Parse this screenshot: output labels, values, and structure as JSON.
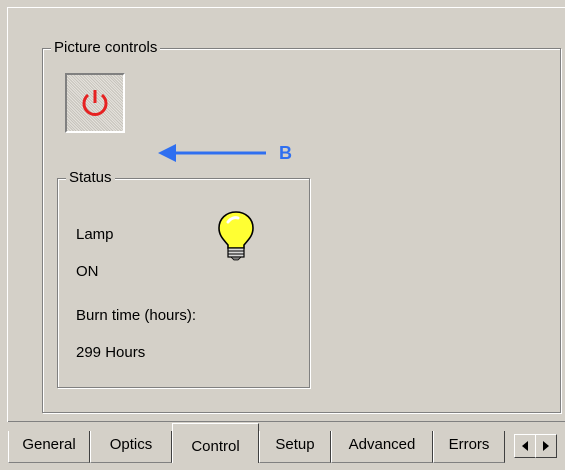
{
  "picture_controls": {
    "title": "Picture controls",
    "power_button": {
      "icon": "power-icon",
      "icon_color": "#e62222"
    },
    "annotation": {
      "label": "B",
      "color": "#2f6ff0"
    }
  },
  "status": {
    "title": "Status",
    "lamp_label": "Lamp",
    "lamp_state": "ON",
    "burn_time_label": "Burn time (hours):",
    "burn_time_value": "299 Hours",
    "lamp_icon": "light-bulb-icon",
    "lamp_icon_color": "#ffff33"
  },
  "tabs": [
    {
      "label": "General",
      "active": false
    },
    {
      "label": "Optics",
      "active": false
    },
    {
      "label": "Control",
      "active": true
    },
    {
      "label": "Setup",
      "active": false
    },
    {
      "label": "Advanced",
      "active": false
    },
    {
      "label": "Errors",
      "active": false
    }
  ],
  "tab_scroll": {
    "left_icon": "left-arrow-icon",
    "right_icon": "right-arrow-icon"
  }
}
